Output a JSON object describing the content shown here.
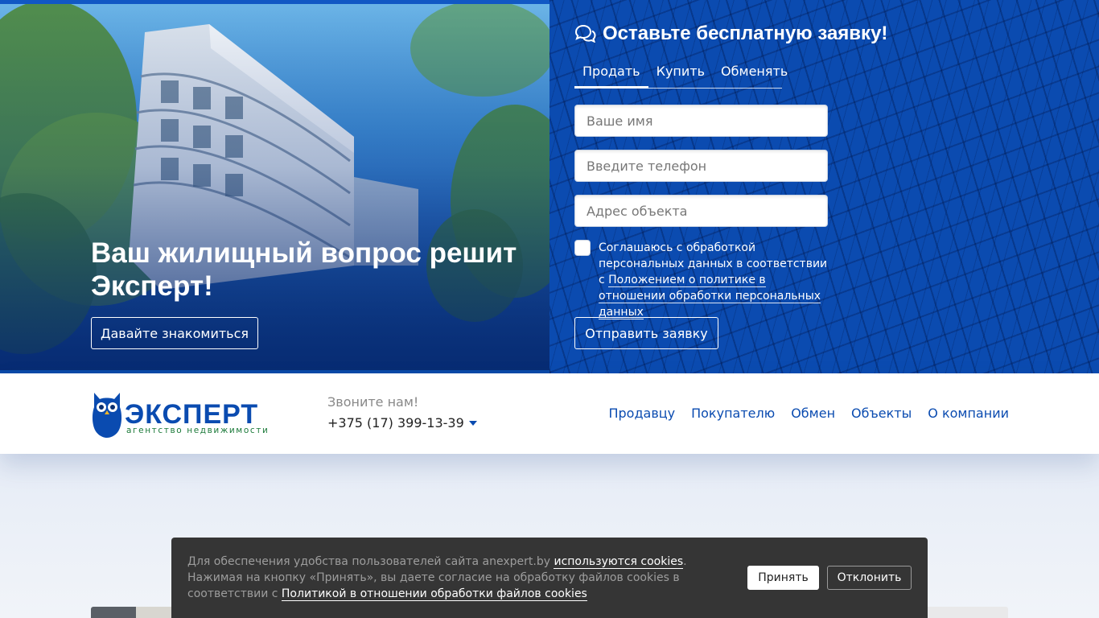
{
  "hero": {
    "title": "Ваш жилищный вопрос решит Эксперт!",
    "cta_label": "Давайте знакомиться",
    "image_icon": "apartment-building-photo"
  },
  "form": {
    "title": "Оставьте бесплатную заявку!",
    "title_icon": "chat-bubbles-icon",
    "tabs": [
      {
        "label": "Продать",
        "active": true
      },
      {
        "label": "Купить",
        "active": false
      },
      {
        "label": "Обменять",
        "active": false
      }
    ],
    "name_placeholder": "Ваше имя",
    "phone_placeholder": "Введите телефон",
    "address_placeholder": "Адрес объекта",
    "consent_text": "Соглашаюсь с обработкой персональных данных в соответствии с ",
    "consent_link": "Положением о политике в отношении обработки персональных данных",
    "consent_checked": false,
    "submit_label": "Отправить заявку"
  },
  "header": {
    "logo_word": "ЭКСПЕРТ",
    "logo_sub": "агентство недвижимости",
    "call_label": "Звоните нам!",
    "phone": "+375 (17) 399-13-39",
    "nav": [
      "Продавцу",
      "Покупателю",
      "Обмен",
      "Объекты",
      "О компании"
    ]
  },
  "cookie": {
    "text_1": "Для обеспечения удобства пользователей сайта anexpert.by ",
    "link_1": "используются cookies",
    "text_2": ". Нажимая на кнопку «Принять», вы даете согласие на обработку файлов cookies в соответствии с ",
    "link_2": "Политикой в отношении обработки файлов cookies",
    "accept_label": "Принять",
    "decline_label": "Отклонить"
  },
  "colors": {
    "brand_blue": "#0a4bb0",
    "logo_green": "#1c7a3a",
    "cookie_bg": "#353535"
  }
}
